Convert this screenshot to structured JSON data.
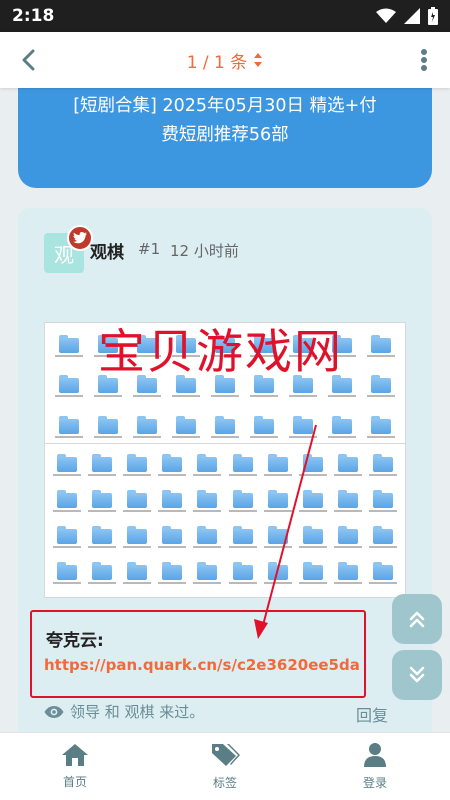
{
  "status_bar": {
    "time": "2:18"
  },
  "header": {
    "pager_label": "1 / 1 条"
  },
  "topic": {
    "title_line1": "[短剧合集] 2025年05月30日 精选+付",
    "title_line2": "费短剧推荐56部"
  },
  "post": {
    "avatar_char": "观",
    "author": "观棋",
    "floor": "#1",
    "time": "12 小时前",
    "watermark": "宝贝游戏网",
    "link_label": "夸克云:",
    "link_url": "https://pan.quark.cn/s/c2e3620ee5da",
    "liked_text": "领导 和 观棋 来过。",
    "reply_label": "回复"
  },
  "bottom_nav": {
    "items": [
      {
        "label": "首页",
        "icon": "home-icon"
      },
      {
        "label": "标签",
        "icon": "tag-icon"
      },
      {
        "label": "登录",
        "icon": "user-icon"
      }
    ]
  },
  "colors": {
    "accent": "#f26a3a",
    "banner": "#3d97e0",
    "card": "#dceef1",
    "watermark": "#e0112b"
  }
}
